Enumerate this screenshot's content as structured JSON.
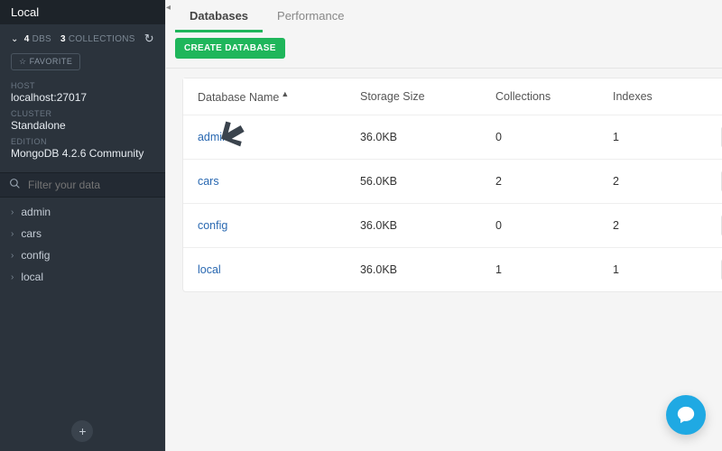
{
  "sidebar": {
    "title": "Local",
    "db_count": "4",
    "db_label": "DBS",
    "coll_count": "3",
    "coll_label": "COLLECTIONS",
    "favorite_label": "☆ FAVORITE",
    "host_label": "HOST",
    "host_value": "localhost:27017",
    "cluster_label": "CLUSTER",
    "cluster_value": "Standalone",
    "edition_label": "EDITION",
    "edition_value": "MongoDB 4.2.6 Community",
    "filter_placeholder": "Filter your data",
    "tree": [
      "admin",
      "cars",
      "config",
      "local"
    ]
  },
  "tabs": {
    "databases": "Databases",
    "performance": "Performance"
  },
  "toolbar": {
    "create_label": "CREATE DATABASE"
  },
  "table": {
    "headers": {
      "name": "Database Name",
      "size": "Storage Size",
      "collections": "Collections",
      "indexes": "Indexes"
    },
    "rows": [
      {
        "name": "admin",
        "size": "36.0KB",
        "collections": "0",
        "indexes": "1"
      },
      {
        "name": "cars",
        "size": "56.0KB",
        "collections": "2",
        "indexes": "2"
      },
      {
        "name": "config",
        "size": "36.0KB",
        "collections": "0",
        "indexes": "2"
      },
      {
        "name": "local",
        "size": "36.0KB",
        "collections": "1",
        "indexes": "1"
      }
    ]
  }
}
